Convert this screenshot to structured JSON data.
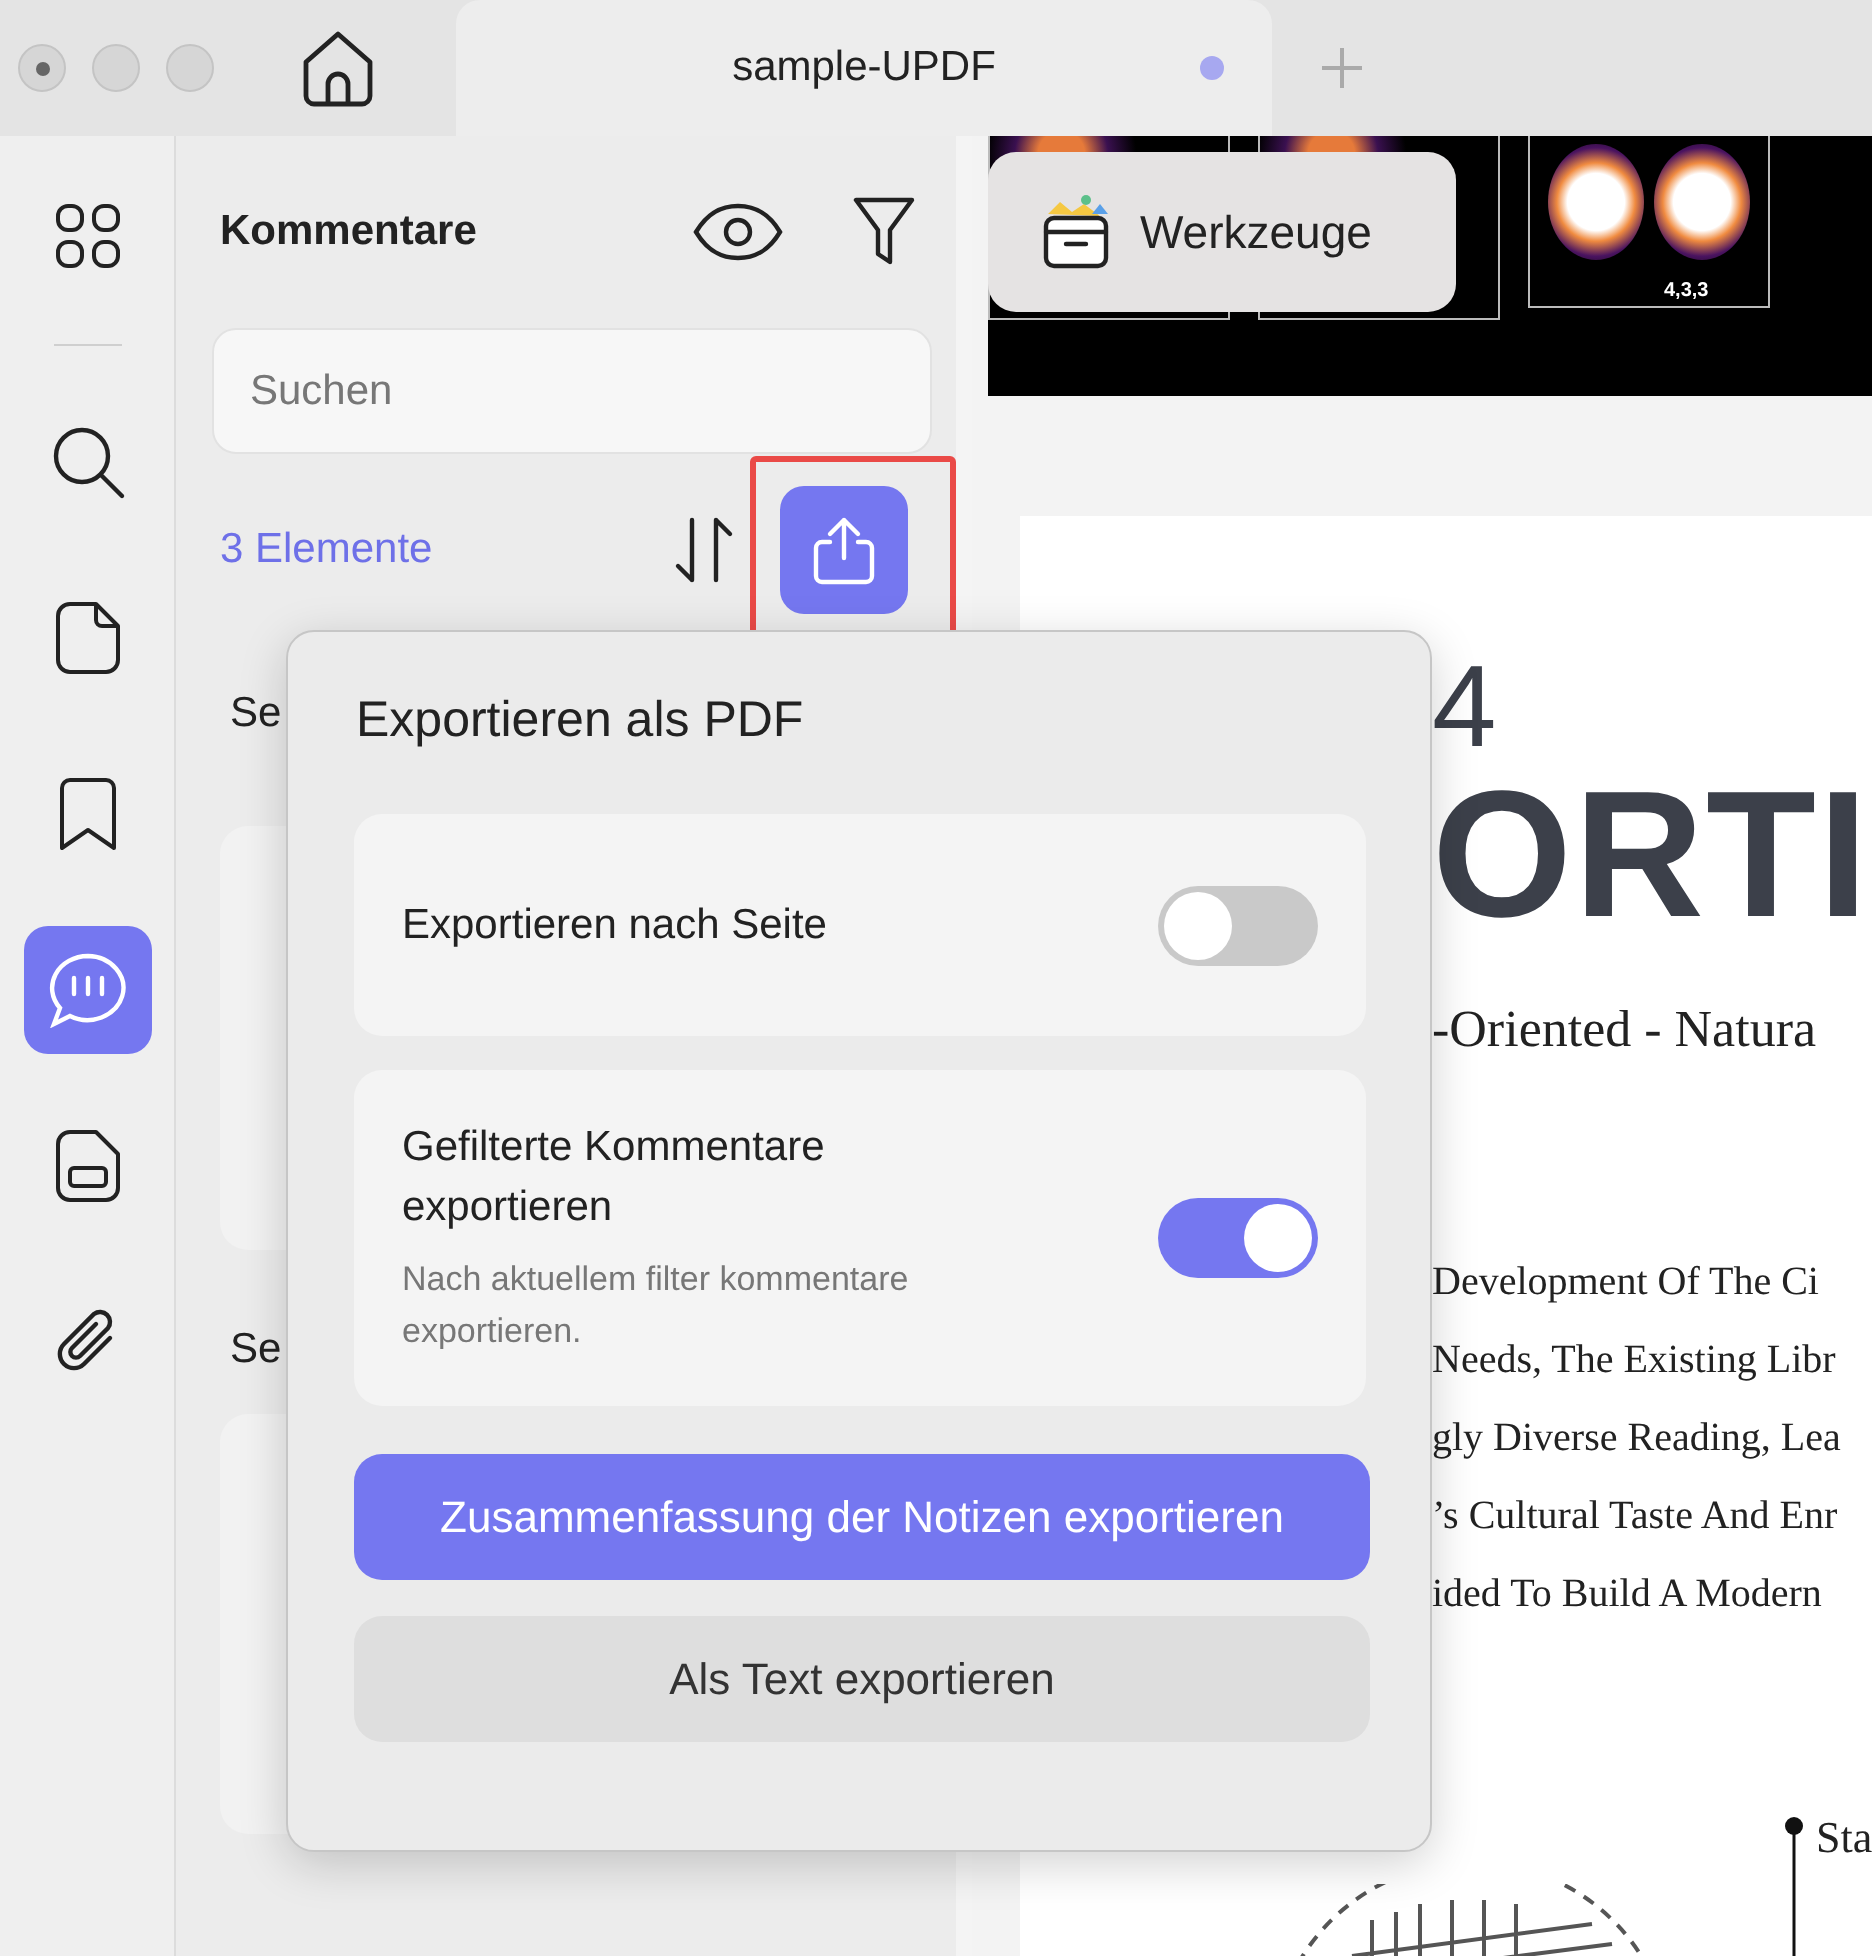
{
  "window": {
    "title": "sample-UPDF"
  },
  "rail": [
    {
      "kind": "grid",
      "selected": false
    },
    {
      "kind": "search",
      "selected": false
    },
    {
      "kind": "page",
      "selected": false
    },
    {
      "kind": "bookmark",
      "selected": false
    },
    {
      "kind": "comment",
      "selected": true
    },
    {
      "kind": "form",
      "selected": false
    },
    {
      "kind": "attachment",
      "selected": false
    }
  ],
  "comments_panel": {
    "title": "Kommentare",
    "search": {
      "placeholder": "Suchen"
    },
    "count": "3 Elemente",
    "sections": [
      {
        "heading": "Se"
      },
      {
        "heading": "Se"
      }
    ]
  },
  "toolbar": {
    "label": "Werkzeuge"
  },
  "document": {
    "figure_label": "4,3,3",
    "heading_number": "4",
    "title": "ORTI",
    "subtitle": "-Oriented - Natura",
    "lines": [
      "Development Of The Ci",
      "Needs, The Existing Libr",
      "gly Diverse Reading, Lea",
      "’s Cultural Taste And Enr",
      "ided To Build A Modern"
    ],
    "callout": "Sta"
  },
  "export_menu": {
    "title": "Exportieren als PDF",
    "options": [
      {
        "label": "Exportieren nach Seite",
        "on": false
      },
      {
        "label": "Gefilterte Kommentare exportieren",
        "hint": "Nach aktuellem filter kommentare exportieren.",
        "on": true
      }
    ],
    "buttons": [
      {
        "label": "Zusammenfassung der Notizen exportieren",
        "kind": "primary"
      },
      {
        "label": "Als Text exportieren",
        "kind": "secondary"
      }
    ]
  }
}
